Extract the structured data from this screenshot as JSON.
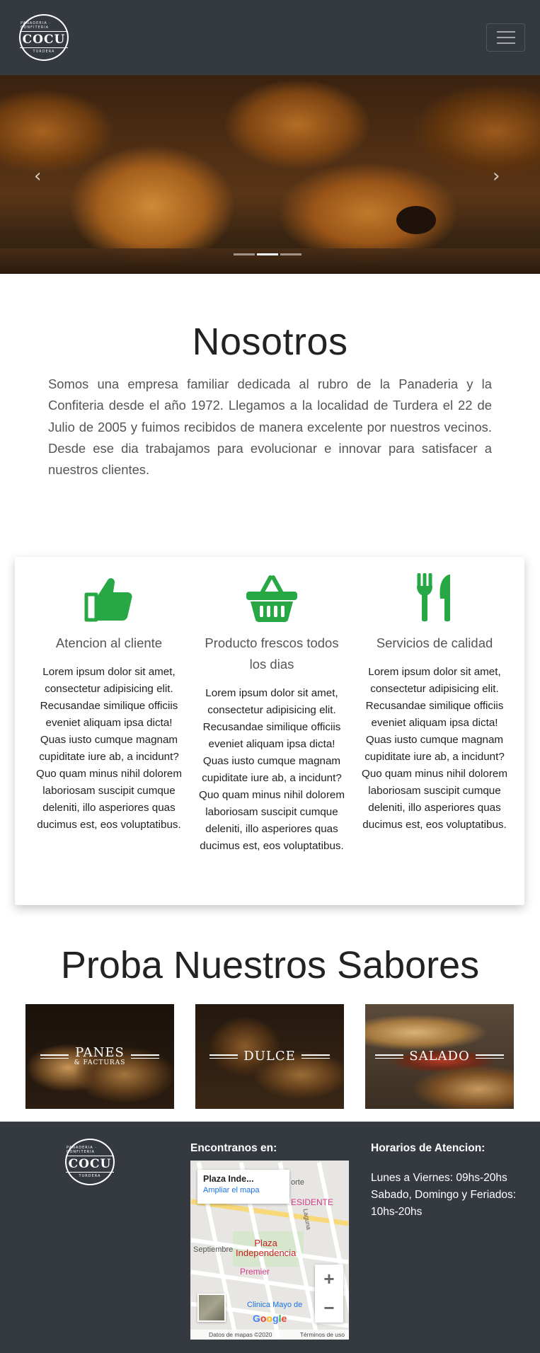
{
  "navbar": {
    "logo_text": "COCU",
    "logo_ring_top": "PANADERIA · CONFITERIA",
    "logo_ring_bottom": "TURDERA",
    "menu_toggle_icon": "hamburger-icon"
  },
  "carousel": {
    "prev_icon": "‹",
    "next_icon": "›",
    "slides_count": 3,
    "active_slide": 1
  },
  "nosotros": {
    "title": "Nosotros",
    "text": "Somos una empresa familiar dedicada al rubro de la Panaderia y la Confiteria desde el año 1972. Llegamos a la localidad de Turdera el 22 de Julio de 2005 y fuimos recibidos de manera excelente por nuestros vecinos. Desde ese dia trabajamos para evolucionar e innovar para satisfacer a nuestros clientes."
  },
  "features": [
    {
      "icon": "thumbs-up-icon",
      "title": "Atencion al cliente",
      "text": "Lorem ipsum dolor sit amet, consectetur adipisicing elit. Recusandae similique officiis eveniet aliquam ipsa dicta! Quas iusto cumque magnam cupiditate iure ab, a incidunt? Quo quam minus nihil dolorem laboriosam suscipit cumque deleniti, illo asperiores quas ducimus est, eos voluptatibus."
    },
    {
      "icon": "basket-icon",
      "title": "Producto frescos todos los dias",
      "text": "Lorem ipsum dolor sit amet, consectetur adipisicing elit. Recusandae similique officiis eveniet aliquam ipsa dicta! Quas iusto cumque magnam cupiditate iure ab, a incidunt? Quo quam minus nihil dolorem laboriosam suscipit cumque deleniti, illo asperiores quas ducimus est, eos voluptatibus."
    },
    {
      "icon": "utensils-icon",
      "title": "Servicios de calidad",
      "text": "Lorem ipsum dolor sit amet, consectetur adipisicing elit. Recusandae similique officiis eveniet aliquam ipsa dicta! Quas iusto cumque magnam cupiditate iure ab, a incidunt? Quo quam minus nihil dolorem laboriosam suscipit cumque deleniti, illo asperiores quas ducimus est, eos voluptatibus."
    }
  ],
  "sabores": {
    "title": "Proba Nuestros Sabores",
    "tiles": [
      {
        "label": "PANES",
        "sublabel": "& FACTURAS"
      },
      {
        "label": "DULCE",
        "sublabel": ""
      },
      {
        "label": "SALADO",
        "sublabel": ""
      }
    ]
  },
  "footer": {
    "logo_text": "COCU",
    "logo_ring_top": "PANADERIA · CONFITERIA",
    "logo_ring_bottom": "TURDERA",
    "location_heading": "Encontranos en:",
    "hours_heading": "Horarios de Atencion:",
    "hours_line_1": "Lunes a Viernes: 09hs-20hs",
    "hours_line_2": "Sabado, Domingo y Feriados:",
    "hours_line_3": "10hs-20hs",
    "map": {
      "place_name": "Plaza Inde...",
      "enlarge_link": "Ampliar el mapa",
      "plaza_label_1": "Plaza",
      "plaza_label_2": "Independencia",
      "poi_premier": "Premier",
      "poi_clinica": "Clinica Mayo de",
      "poi_residente": "ESIDENTE",
      "street_septiembre": "Septiembre",
      "street_lagunita": "Laguna",
      "street_norte": "orte",
      "zoom_in": "+",
      "zoom_out": "−",
      "google": "Google",
      "attribution": "Datos de mapas ©2020",
      "terms": "Términos de uso"
    }
  },
  "colors": {
    "navbar_bg": "#343a40",
    "accent_green": "#28a745",
    "footer_bg": "#343a40"
  }
}
